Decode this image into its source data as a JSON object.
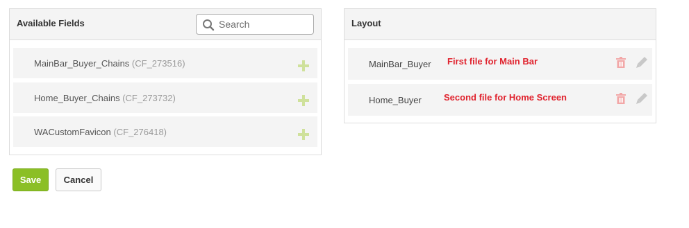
{
  "available_fields": {
    "title": "Available Fields",
    "search": {
      "placeholder": "Search",
      "value": ""
    },
    "items": [
      {
        "name": "MainBar_Buyer_Chains",
        "code": "(CF_273516)"
      },
      {
        "name": "Home_Buyer_Chains",
        "code": "(CF_273732)"
      },
      {
        "name": "WACustomFavicon",
        "code": "(CF_276418)"
      }
    ]
  },
  "layout": {
    "title": "Layout",
    "items": [
      {
        "name": "MainBar_Buyer",
        "note": "First file for Main Bar"
      },
      {
        "name": "Home_Buyer",
        "note": "Second file for Home Screen"
      }
    ]
  },
  "actions": {
    "save_label": "Save",
    "cancel_label": "Cancel"
  },
  "colors": {
    "save_button": "#8bbf26",
    "note_text": "#e0232e",
    "plus_icon": "#cfe19b",
    "action_icons": "#f2a7a7",
    "pencil_icon": "#c8c8c8"
  },
  "icons": {
    "search": "search-icon",
    "add": "plus-icon",
    "delete": "trash-icon",
    "edit": "pencil-icon"
  }
}
